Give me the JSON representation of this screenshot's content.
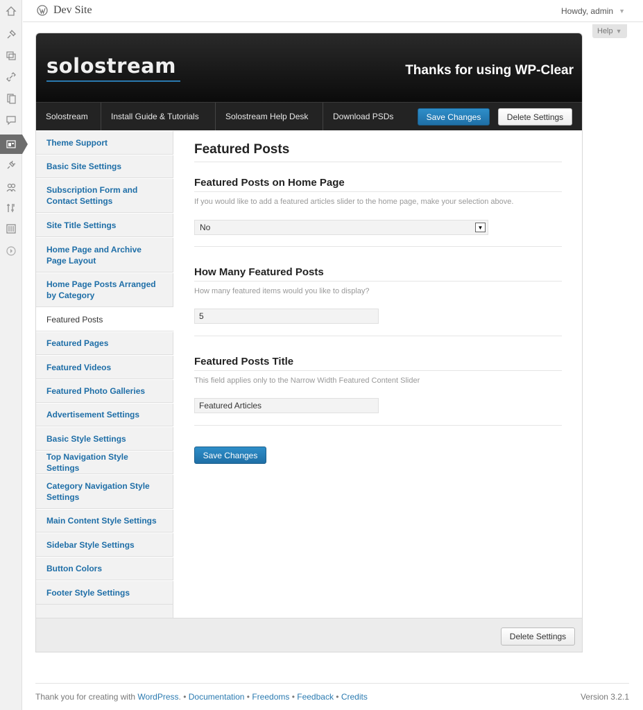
{
  "header": {
    "site_title": "Dev Site",
    "howdy": "Howdy, admin",
    "howdy_caret": "▼",
    "help_label": "Help",
    "help_caret": "▼"
  },
  "admin_menu": {
    "icons": [
      "dashboard-icon",
      "posts-icon",
      "media-icon",
      "links-icon",
      "pages-icon",
      "comments-icon",
      "appearance-icon",
      "plugins-icon",
      "users-icon",
      "tools-icon",
      "settings-icon",
      "collapse-icon"
    ],
    "current": "appearance-icon"
  },
  "banner": {
    "brand": "solostream",
    "tagline": "Thanks for using WP-Clear"
  },
  "topnav": {
    "links": [
      "Solostream",
      "Install Guide & Tutorials",
      "Solostream Help Desk",
      "Download PSDs"
    ],
    "save_label": "Save Changes",
    "delete_label": "Delete Settings"
  },
  "sidebar": {
    "items": [
      {
        "label": "Theme Support"
      },
      {
        "label": "Basic Site Settings"
      },
      {
        "label": "Subscription Form and Contact Settings"
      },
      {
        "label": "Site Title Settings"
      },
      {
        "label": "Home Page and Archive Page Layout"
      },
      {
        "label": "Home Page Posts Arranged by Category"
      },
      {
        "label": "Featured Posts"
      },
      {
        "label": "Featured Pages"
      },
      {
        "label": "Featured Videos"
      },
      {
        "label": "Featured Photo Galleries"
      },
      {
        "label": "Advertisement Settings"
      },
      {
        "label": "Basic Style Settings"
      },
      {
        "label": "Top Navigation Style Settings"
      },
      {
        "label": "Category Navigation Style Settings"
      },
      {
        "label": "Main Content Style Settings"
      },
      {
        "label": "Sidebar Style Settings"
      },
      {
        "label": "Button Colors"
      },
      {
        "label": "Footer Style Settings"
      }
    ],
    "active": "Featured Posts"
  },
  "main": {
    "title": "Featured Posts",
    "sections": [
      {
        "title": "Featured Posts on Home Page",
        "description": "If you would like to add a featured articles slider to the home page, make your selection above.",
        "field_type": "select",
        "value": "No"
      },
      {
        "title": "How Many Featured Posts",
        "description": "How many featured items would you like to display?",
        "field_type": "text",
        "value": "5"
      },
      {
        "title": "Featured Posts Title",
        "description": "This field applies only to the Narrow Width Featured Content Slider",
        "field_type": "text",
        "value": "Featured Articles"
      }
    ],
    "save_label": "Save Changes"
  },
  "panel_footer": {
    "delete_label": "Delete Settings"
  },
  "footer": {
    "thanks_text": "Thank you for creating with ",
    "wordpress_link": "WordPress",
    "after_wordpress": ". • ",
    "documentation": "Documentation",
    "freedoms": "Freedoms",
    "feedback": "Feedback",
    "credits": "Credits",
    "sep": " • ",
    "version": "Version 3.2.1"
  },
  "colors": {
    "accent": "#1e6ea7",
    "banner_bg": "#0b0b0b",
    "button_blue": "#2e8ec9"
  }
}
